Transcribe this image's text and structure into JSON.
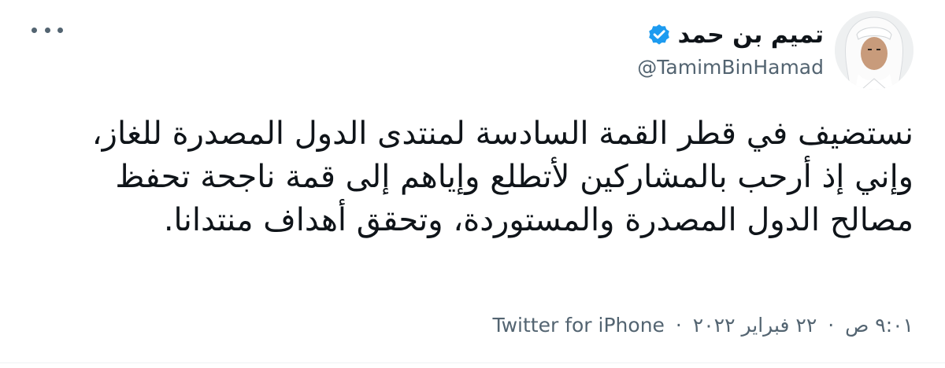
{
  "author": {
    "display_name": "تميم بن حمد",
    "handle": "@TamimBinHamad",
    "avatar_icon": "profile-photo",
    "verified_icon": "verified-badge-icon",
    "verified_color": "#1d9bf0"
  },
  "tweet": {
    "text": "نستضيف في قطر القمة السادسة لمنتدى الدول المصدرة للغاز، وإني إذ أرحب بالمشاركين لأتطلع وإياهم إلى قمة ناجحة تحفظ مصالح الدول المصدرة والمستوردة، وتحقق أهداف منتدانا."
  },
  "meta": {
    "time": "٩:٠١ ص",
    "separator": "·",
    "date": "٢٢ فبراير ٢٠٢٢",
    "source": "Twitter for iPhone"
  },
  "menu": {
    "more_icon": "more-horizontal-icon"
  }
}
